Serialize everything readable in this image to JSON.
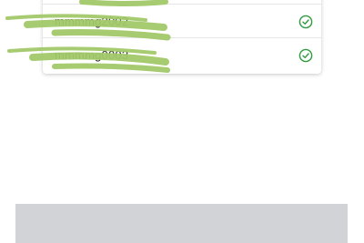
{
  "list": {
    "rows": [
      {
        "label": "mmmmg2002",
        "status": "verified",
        "status_icon": "check-circle-icon",
        "status_color": "#2e9a3e"
      },
      {
        "label": "mmmmg0003",
        "status": "verified",
        "status_icon": "check-circle-icon",
        "status_color": "#2e9a3e"
      }
    ]
  },
  "redaction": {
    "color": "#a3c96a"
  },
  "footer": {
    "background": "#d1d3d7"
  }
}
